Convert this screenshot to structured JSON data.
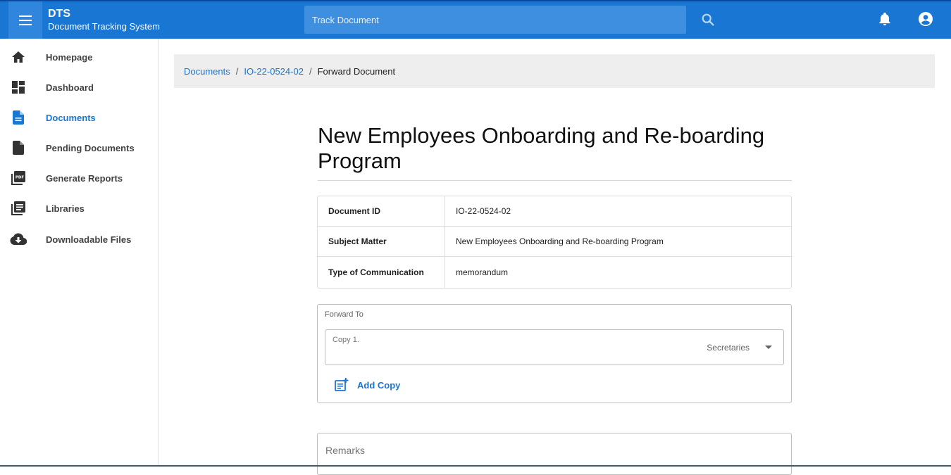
{
  "header": {
    "app_name": "DTS",
    "app_subtitle": "Document Tracking System",
    "search_placeholder": "Track Document",
    "icons": [
      "menu-icon",
      "search-icon",
      "bell-icon",
      "account-circle-icon"
    ],
    "accent_color": "#1976d2"
  },
  "sidebar": {
    "items": [
      {
        "label": "Homepage",
        "icon": "home-icon"
      },
      {
        "label": "Dashboard",
        "icon": "dashboard-icon"
      },
      {
        "label": "Documents",
        "icon": "document-icon",
        "active": true
      },
      {
        "label": "Pending Documents",
        "icon": "pending-document-icon"
      },
      {
        "label": "Generate Reports",
        "icon": "pdf-icon"
      },
      {
        "label": "Libraries",
        "icon": "library-icon"
      },
      {
        "label": "Downloadable Files",
        "icon": "cloud-download-icon"
      }
    ]
  },
  "breadcrumb": {
    "items": [
      "Documents",
      "IO-22-0524-02"
    ],
    "current": "Forward Document",
    "separator": "/"
  },
  "document": {
    "title": "New Employees Onboarding and Re-boarding Program",
    "rows": [
      {
        "key": "Document ID",
        "value": "IO-22-0524-02"
      },
      {
        "key": "Subject Matter",
        "value": "New Employees Onboarding and Re-boarding Program"
      },
      {
        "key": "Type of Communication",
        "value": "memorandum"
      }
    ]
  },
  "forward": {
    "label": "Forward To",
    "copy_label": "Copy 1.",
    "copy_value": "Secretaries",
    "add_copy_label": "Add Copy"
  },
  "remarks": {
    "label": "Remarks"
  }
}
